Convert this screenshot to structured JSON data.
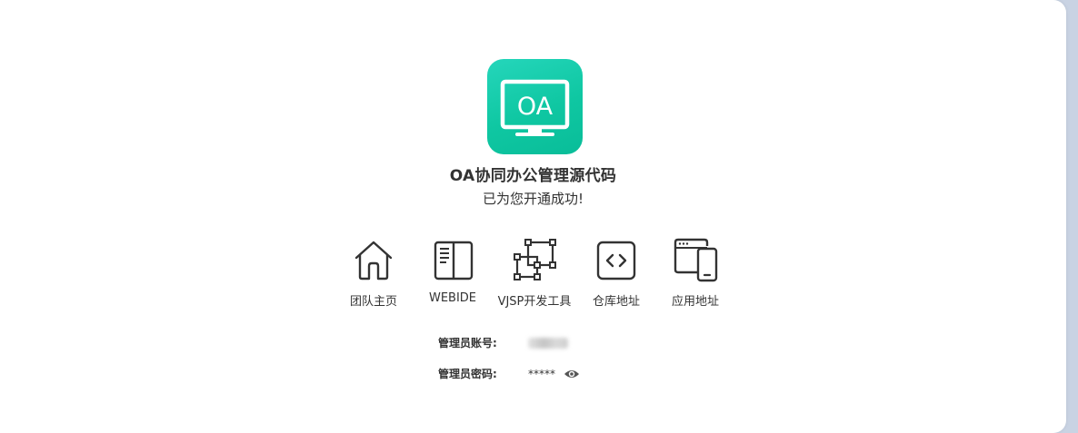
{
  "app": {
    "logo_text": "OA",
    "title": "OA协同办公管理源代码",
    "subtitle": "已为您开通成功!"
  },
  "links": [
    {
      "label": "团队主页",
      "icon": "home-icon"
    },
    {
      "label": "WEBIDE",
      "icon": "book-icon"
    },
    {
      "label": "VJSP开发工具",
      "icon": "vector-nodes-icon"
    },
    {
      "label": "仓库地址",
      "icon": "code-brackets-icon"
    },
    {
      "label": "应用地址",
      "icon": "browser-mobile-icon"
    }
  ],
  "credentials": {
    "account_label": "管理员账号:",
    "password_label": "管理员密码:",
    "password_value": "*****"
  },
  "colors": {
    "brand_green": "#0fc7a2",
    "text": "#333333",
    "backdrop": "#c9d3e3"
  }
}
